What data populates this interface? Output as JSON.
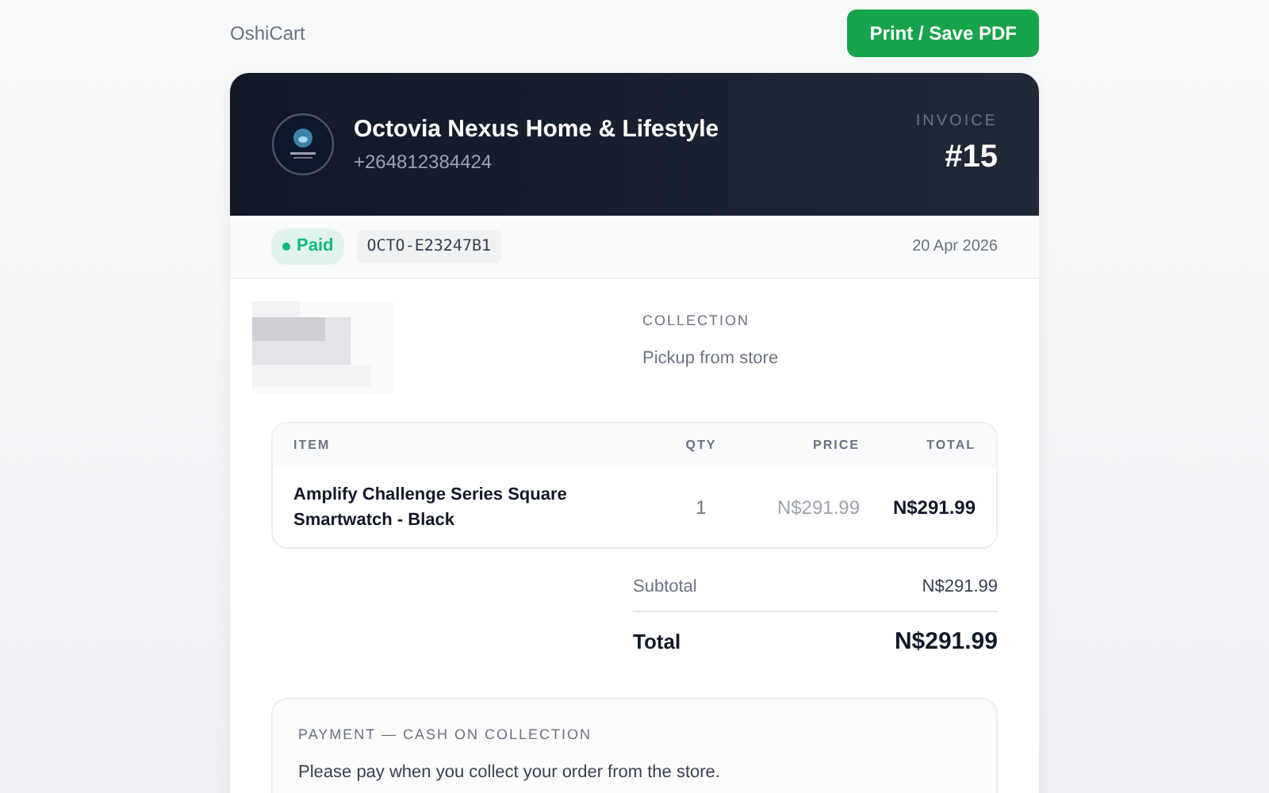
{
  "brand": "OshiCart",
  "print_button": "Print / Save PDF",
  "store": {
    "name": "Octovia Nexus Home & Lifestyle",
    "phone": "+264812384424"
  },
  "invoice": {
    "label": "INVOICE",
    "number": "#15"
  },
  "status": {
    "label": "Paid",
    "color": "#10b981"
  },
  "order_code": "OCTO-E23247B1",
  "date": "20 Apr 2026",
  "collection": {
    "label": "COLLECTION",
    "value": "Pickup from store"
  },
  "table": {
    "columns": [
      "ITEM",
      "QTY",
      "PRICE",
      "TOTAL"
    ],
    "rows": [
      {
        "item": "Amplify Challenge Series Square Smartwatch - Black",
        "qty": "1",
        "price": "N$291.99",
        "total": "N$291.99"
      }
    ]
  },
  "totals": [
    {
      "kind": "sub",
      "label": "Subtotal",
      "value": "N$291.99"
    },
    {
      "kind": "grand",
      "label": "Total",
      "value": "N$291.99"
    }
  ],
  "payment": {
    "title": "PAYMENT — CASH ON COLLECTION",
    "text": "Please pay when you collect your order from the store."
  }
}
